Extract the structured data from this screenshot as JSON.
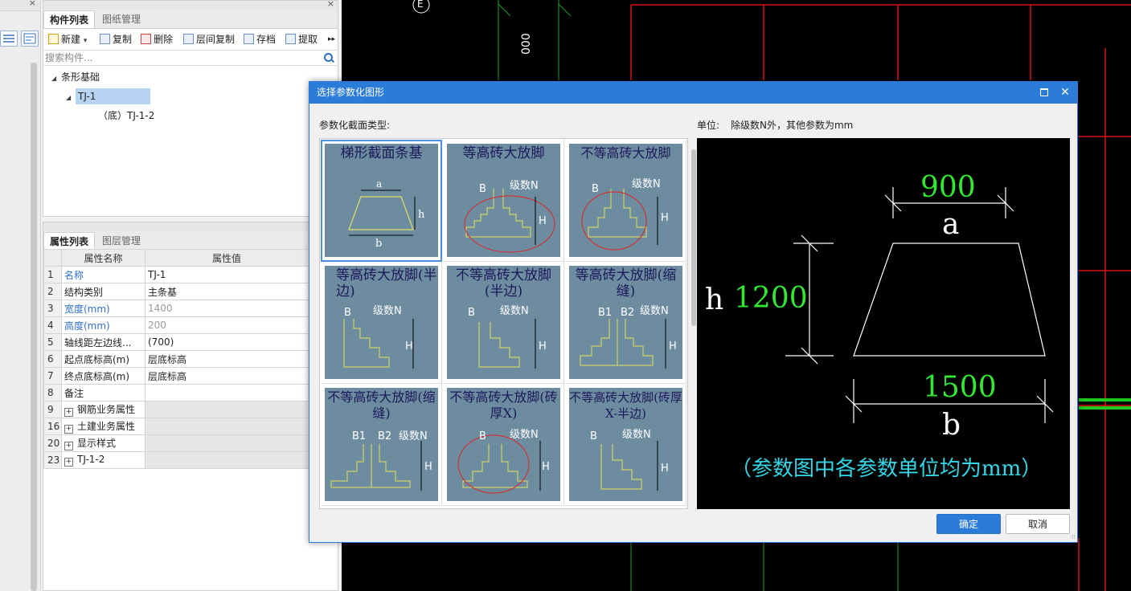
{
  "window": {
    "close_glyph": "×"
  },
  "component_panel": {
    "tabs": [
      "构件列表",
      "图纸管理"
    ],
    "toolbar": {
      "new": "新建",
      "dropdown_glyph": "▾",
      "copy": "复制",
      "delete": "删除",
      "floor_copy": "层间复制",
      "save": "存档",
      "extract": "提取",
      "more": "▸▸"
    },
    "search_placeholder": "搜索构件...",
    "tree": {
      "root": "条形基础",
      "child": "TJ-1",
      "grandchild": "（底）TJ-1-2"
    }
  },
  "property_panel": {
    "tabs": [
      "属性列表",
      "图层管理"
    ],
    "headers": {
      "name": "属性名称",
      "value": "属性值"
    },
    "rows": [
      {
        "num": "1",
        "name": "名称",
        "value": "TJ-1",
        "name_style": "blue",
        "value_style": ""
      },
      {
        "num": "2",
        "name": "结构类别",
        "value": "主条基",
        "name_style": "",
        "value_style": ""
      },
      {
        "num": "3",
        "name": "宽度(mm)",
        "value": "1400",
        "name_style": "blue",
        "value_style": "gray"
      },
      {
        "num": "4",
        "name": "高度(mm)",
        "value": "200",
        "name_style": "blue",
        "value_style": "gray"
      },
      {
        "num": "5",
        "name": "轴线距左边线...",
        "value": "(700)",
        "name_style": "",
        "value_style": ""
      },
      {
        "num": "6",
        "name": "起点底标高(m)",
        "value": "层底标高",
        "name_style": "",
        "value_style": ""
      },
      {
        "num": "7",
        "name": "终点底标高(m)",
        "value": "层底标高",
        "name_style": "",
        "value_style": ""
      },
      {
        "num": "8",
        "name": "备注",
        "value": "",
        "name_style": "",
        "value_style": ""
      },
      {
        "num": "9",
        "name": "钢筋业务属性",
        "value": "",
        "group": true
      },
      {
        "num": "16",
        "name": "土建业务属性",
        "value": "",
        "group": true
      },
      {
        "num": "20",
        "name": "显示样式",
        "value": "",
        "group": true
      },
      {
        "num": "23",
        "name": "TJ-1-2",
        "value": "",
        "group": true
      }
    ]
  },
  "cad": {
    "axis_label": "E",
    "dim_text": "000"
  },
  "dialog": {
    "title": "选择参数化图形",
    "maximize_glyph": "□",
    "close_glyph": "✕",
    "section_label": "参数化截面类型:",
    "unit_label": "单位:",
    "unit_value": "除级数N外，其他参数为mm",
    "shapes": [
      {
        "title": "梯形截面条基",
        "labels": [
          "a",
          "h",
          "b"
        ]
      },
      {
        "title": "等高砖大放脚",
        "labels": [
          "B",
          "级数N",
          "H"
        ]
      },
      {
        "title": "不等高砖大放脚",
        "labels": [
          "B",
          "级数N",
          "H"
        ]
      },
      {
        "title": "等高砖大放脚(半边)",
        "labels": [
          "B",
          "级数N",
          "H"
        ]
      },
      {
        "title": "不等高砖大放脚(半边)",
        "labels": [
          "B",
          "级数N",
          "H"
        ]
      },
      {
        "title": "等高砖大放脚(缩缝)",
        "labels": [
          "B1",
          "B2",
          "级数N",
          "H"
        ]
      },
      {
        "title": "不等高砖大放脚(缩缝)",
        "labels": [
          "B1",
          "B2",
          "级数N",
          "H"
        ]
      },
      {
        "title": "不等高砖大放脚(砖厚X)",
        "labels": [
          "B",
          "级数N",
          "H"
        ]
      },
      {
        "title": "不等高砖大放脚(砖厚X-半边)",
        "labels": [
          "B",
          "级数N",
          "H"
        ]
      }
    ],
    "preview": {
      "a_value": "900",
      "a_label": "a",
      "h_label": "h",
      "h_value": "1200",
      "b_value": "1500",
      "b_label": "b",
      "note": "（参数图中各参数单位均为mm）"
    },
    "ok": "确定",
    "cancel": "取消",
    "grip_glyph": "⁞⁞"
  },
  "colors": {
    "title_bar": "#2b7bd8",
    "thumb_bg": "#6e8ca0",
    "preview_green": "#33e833",
    "preview_cyan": "#33d6e6",
    "cad_red": "#e01010",
    "cad_green": "#1fa01f"
  }
}
